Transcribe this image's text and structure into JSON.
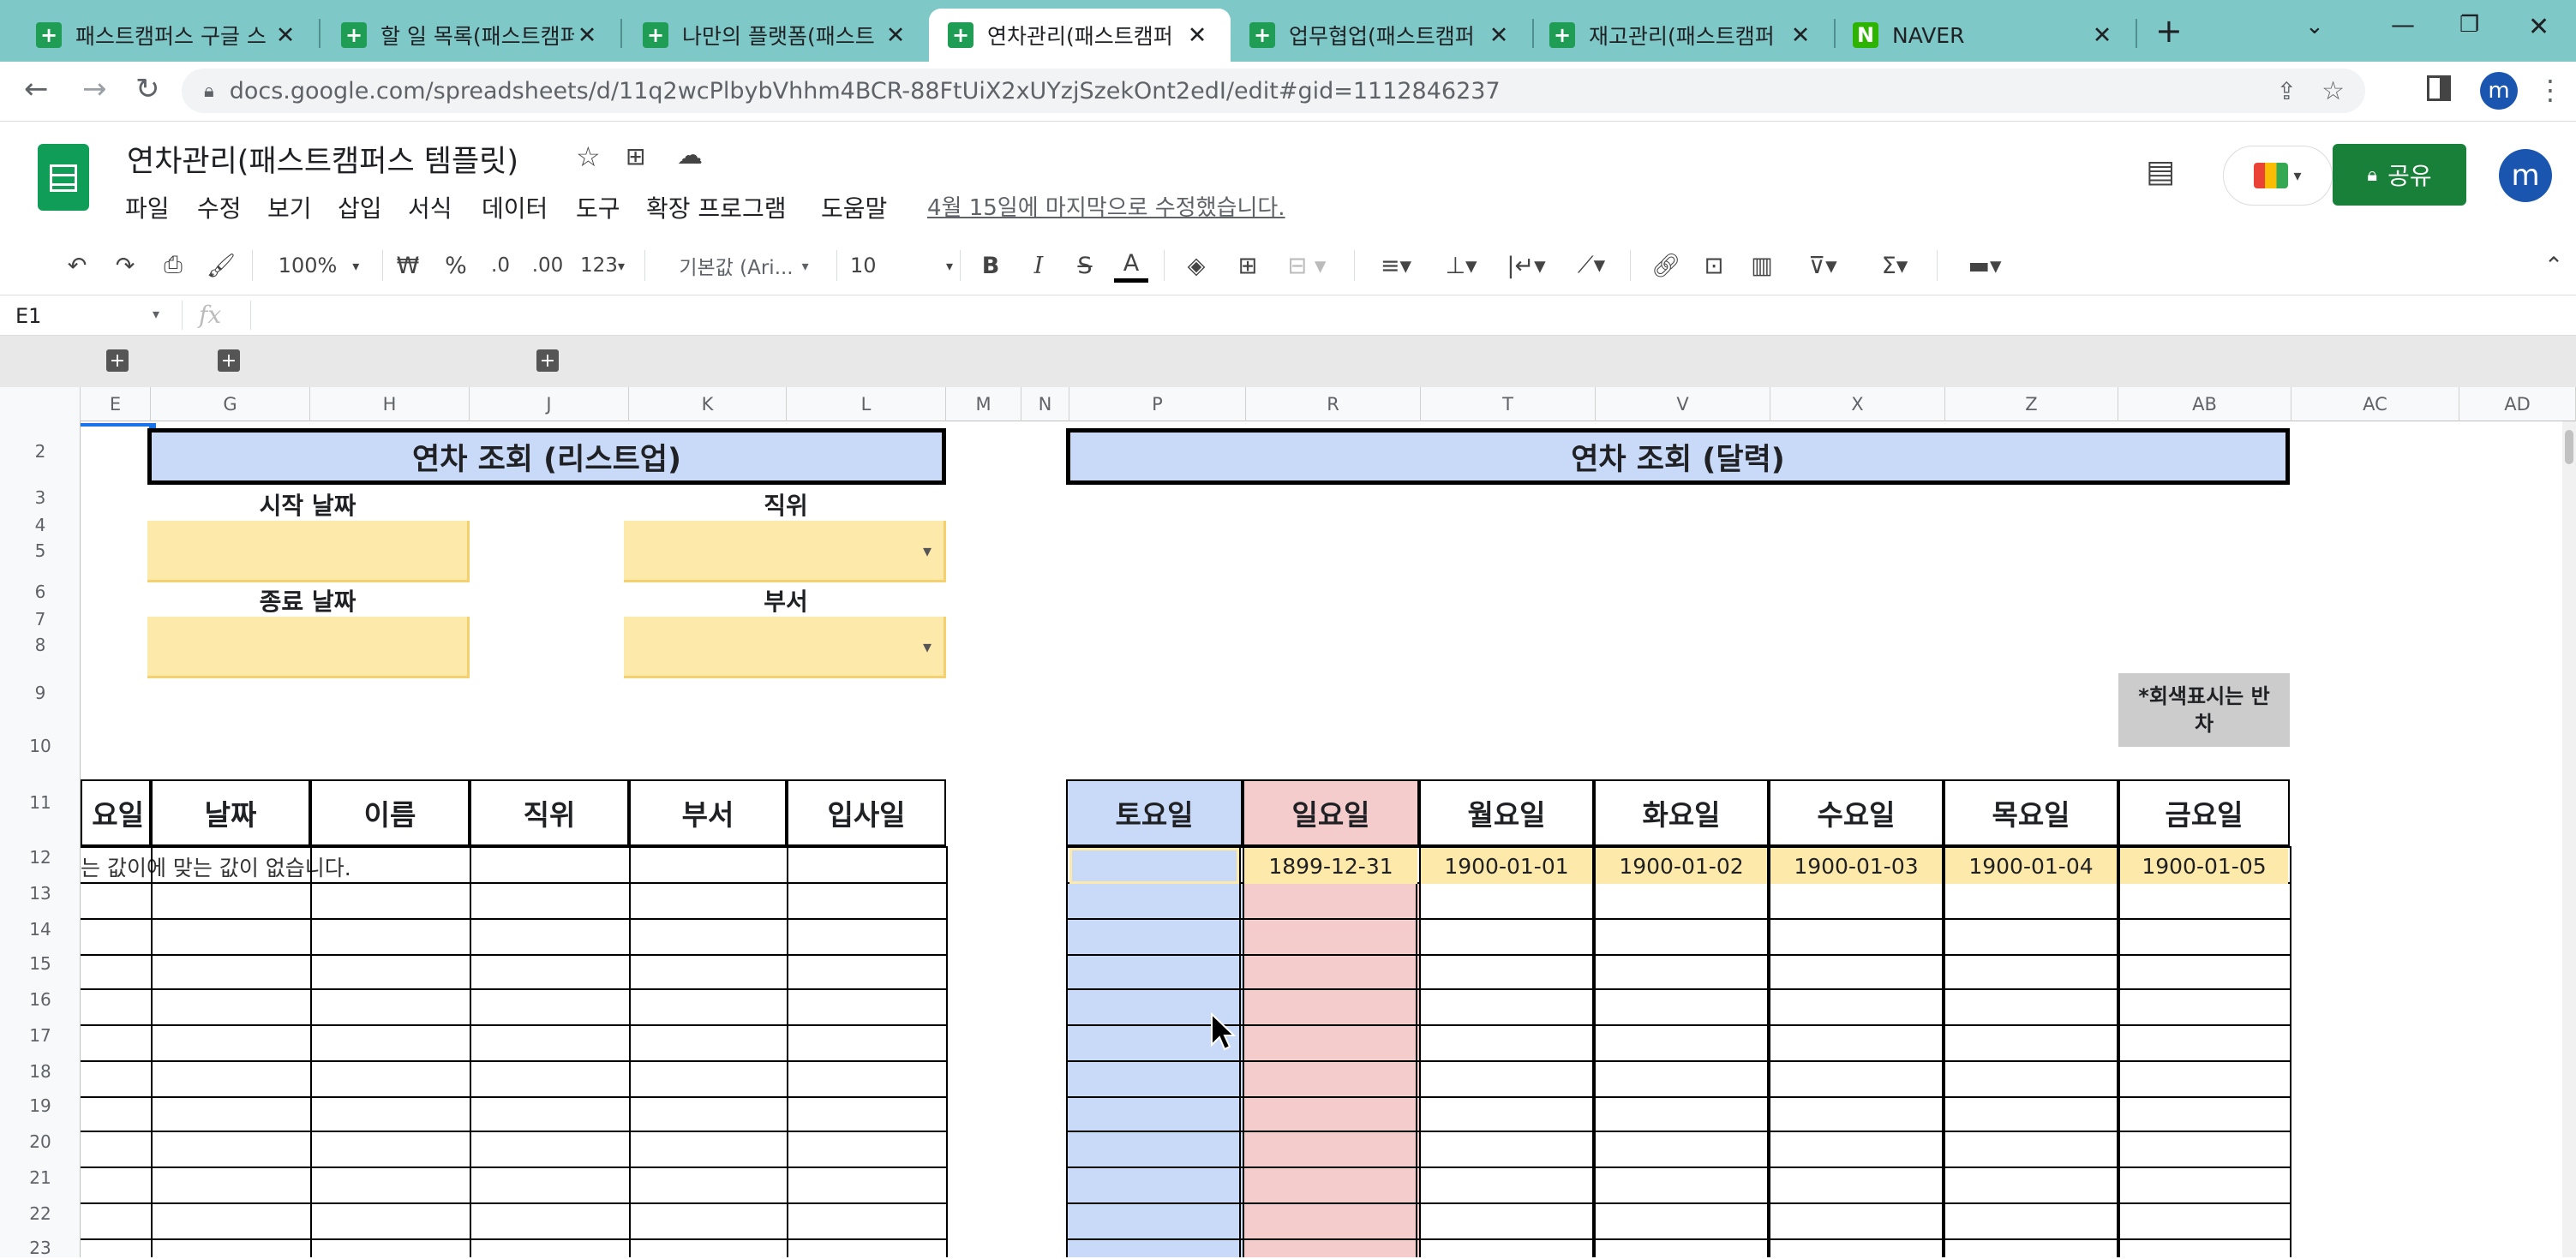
{
  "browser": {
    "tabs": [
      {
        "title": "패스트캠퍼스 구글 스",
        "active": false
      },
      {
        "title": "할 일 목록(패스트캠퍼",
        "active": false
      },
      {
        "title": "나만의 플랫폼(패스트",
        "active": false
      },
      {
        "title": "연차관리(패스트캠퍼",
        "active": true
      },
      {
        "title": "업무협업(패스트캠퍼",
        "active": false
      },
      {
        "title": "재고관리(패스트캠퍼",
        "active": false
      },
      {
        "title": "NAVER",
        "active": false
      }
    ],
    "url": "docs.google.com/spreadsheets/d/11q2wcPlbybVhhm4BCR-88FtUiX2xUYzjSzekOnt2edI/edit#gid=1112846237",
    "profile_initial": "m"
  },
  "doc": {
    "title": "연차관리(패스트캠퍼스 템플릿)",
    "menus": [
      "파일",
      "수정",
      "보기",
      "삽입",
      "서식",
      "데이터",
      "도구",
      "확장 프로그램",
      "도움말"
    ],
    "last_edit": "4월 15일에 마지막으로 수정했습니다.",
    "share_label": "공유",
    "avatar_initial": "m"
  },
  "toolbar": {
    "zoom": "100%",
    "currency": "₩",
    "percent": "%",
    "dec_decrease": ".0",
    "dec_increase": ".00",
    "format_more": "123",
    "font": "기본값 (Ari...",
    "font_size": "10",
    "bold": "B",
    "italic": "I",
    "strike": "S",
    "text_color": "A"
  },
  "formula_bar": {
    "cell_ref": "E1",
    "fx": "fx",
    "content": ""
  },
  "columns": [
    "E",
    "G",
    "H",
    "J",
    "K",
    "L",
    "M",
    "N",
    "P",
    "R",
    "T",
    "V",
    "X",
    "Z",
    "AB",
    "AC",
    "AD"
  ],
  "rows": [
    "2",
    "3",
    "4",
    "5",
    "6",
    "7",
    "8",
    "9",
    "10",
    "11",
    "12",
    "13",
    "14",
    "15",
    "16",
    "17",
    "18",
    "19",
    "20",
    "21",
    "22",
    "23"
  ],
  "list_section": {
    "title": "연차 조회 (리스트업)",
    "start_label": "시작 날짜",
    "end_label": "종료 날짜",
    "position_label": "직위",
    "dept_label": "부서",
    "headers": [
      "요일",
      "날짜",
      "이름",
      "직위",
      "부서",
      "입사일"
    ],
    "message": "는 값이에 맞는 값이 없습니다."
  },
  "calendar_section": {
    "title": "연차 조회 (달력)",
    "note": "*회색표시는 반차",
    "days": [
      "토요일",
      "일요일",
      "월요일",
      "화요일",
      "수요일",
      "목요일",
      "금요일"
    ],
    "dates": [
      "",
      "1899-12-31",
      "1900-01-01",
      "1900-01-02",
      "1900-01-03",
      "1900-01-04",
      "1900-01-05"
    ]
  }
}
